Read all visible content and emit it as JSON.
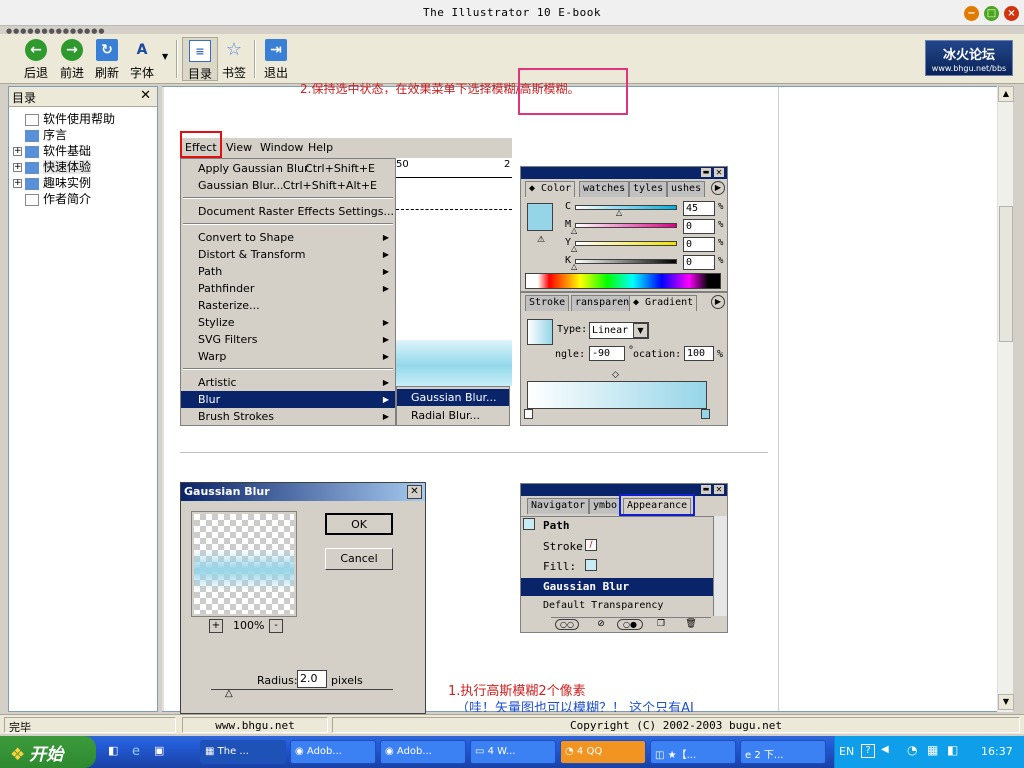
{
  "window": {
    "title": "The Illustrator 10 E-book"
  },
  "toolbar": {
    "back": "后退",
    "forward": "前进",
    "refresh": "刷新",
    "font": "字体",
    "toc": "目录",
    "bookmark": "书签",
    "exit": "退出"
  },
  "logo": {
    "text": "冰火论坛",
    "sub": "www.bhgu.net/bbs"
  },
  "sidebar": {
    "title": "目录",
    "items": [
      {
        "label": "软件使用帮助",
        "expander": ""
      },
      {
        "label": "序言",
        "expander": ""
      },
      {
        "label": "软件基础",
        "expander": "+"
      },
      {
        "label": "快速体验",
        "expander": "+"
      },
      {
        "label": "趣味实例",
        "expander": "+"
      },
      {
        "label": "作者简介",
        "expander": ""
      }
    ]
  },
  "content": {
    "top_note": "2.保持选中状态，在效果菜单下选择模糊/高斯模糊。",
    "menubar": [
      "Effect",
      "View",
      "Window",
      "Help"
    ],
    "ruler_label": "50",
    "ruler_label2": "2",
    "menu": {
      "items1": [
        {
          "label": "Apply Gaussian Blur",
          "shortcut": "Ctrl+Shift+E"
        },
        {
          "label": "Gaussian Blur...",
          "shortcut": "Ctrl+Shift+Alt+E"
        }
      ],
      "items2": [
        {
          "label": "Document Raster Effects Settings..."
        }
      ],
      "items3": [
        {
          "label": "Convert to Shape",
          "arrow": "▶"
        },
        {
          "label": "Distort & Transform",
          "arrow": "▶"
        },
        {
          "label": "Path",
          "arrow": "▶"
        },
        {
          "label": "Pathfinder",
          "arrow": "▶"
        },
        {
          "label": "Rasterize...",
          "arrow": ""
        },
        {
          "label": "Stylize",
          "arrow": "▶"
        },
        {
          "label": "SVG Filters",
          "arrow": "▶"
        },
        {
          "label": "Warp",
          "arrow": "▶"
        }
      ],
      "items4": [
        {
          "label": "Artistic",
          "arrow": "▶"
        },
        {
          "label": "Blur",
          "arrow": "▶"
        },
        {
          "label": "Brush Strokes",
          "arrow": "▶"
        }
      ]
    },
    "submenu": [
      "Gaussian Blur...",
      "Radial Blur..."
    ],
    "color_panel": {
      "tabs": [
        "◆ Color",
        "watches",
        "tyles",
        "ushes"
      ],
      "channels": [
        {
          "name": "C",
          "value": "45",
          "unit": "%",
          "pos": 0.45
        },
        {
          "name": "M",
          "value": "0",
          "unit": "%",
          "pos": 0
        },
        {
          "name": "Y",
          "value": "0",
          "unit": "%",
          "pos": 0
        },
        {
          "name": "K",
          "value": "0",
          "unit": "%",
          "pos": 0
        }
      ]
    },
    "gradient_panel": {
      "tabs": [
        "Stroke",
        "ransparen",
        "◆ Gradient"
      ],
      "type_label": "Type:",
      "type_value": "Linear",
      "angle_label": "ngle:",
      "angle_value": "-90",
      "deg": "°",
      "location_label": "ocation:",
      "location_value": "100",
      "unit": "%"
    },
    "appearance_panel": {
      "tabs": [
        "Navigator",
        "ymbo",
        "Appearance"
      ],
      "rows": [
        {
          "label": "Path"
        },
        {
          "label": "Stroke:"
        },
        {
          "label": "Fill:"
        },
        {
          "label": "Gaussian Blur"
        },
        {
          "label": "Default Transparency"
        }
      ]
    },
    "gaussian_dialog": {
      "title": "Gaussian Blur",
      "ok": "OK",
      "cancel": "Cancel",
      "zoom": "100%",
      "plus": "+",
      "minus": "-",
      "radius_label": "Radius:",
      "radius_value": "2.0",
      "radius_unit": "pixels"
    },
    "caption1": "1.执行高斯模糊2个像素",
    "caption2": "（哇！矢量图也可以模糊？！ 这个只有AI"
  },
  "status": {
    "left": "完毕",
    "middle": "www.bhgu.net",
    "right": "Copyright (C) 2002-2003 bugu.net"
  },
  "taskbar": {
    "start": "开始",
    "tasks": [
      {
        "label": "The ..."
      },
      {
        "label": "Adob..."
      },
      {
        "label": "Adob..."
      },
      {
        "label": "4 W..."
      },
      {
        "label": "4 QQ"
      },
      {
        "label": "★【..."
      },
      {
        "label": "2 下..."
      }
    ],
    "lang": "EN",
    "help": "?",
    "clock": "16:37"
  }
}
